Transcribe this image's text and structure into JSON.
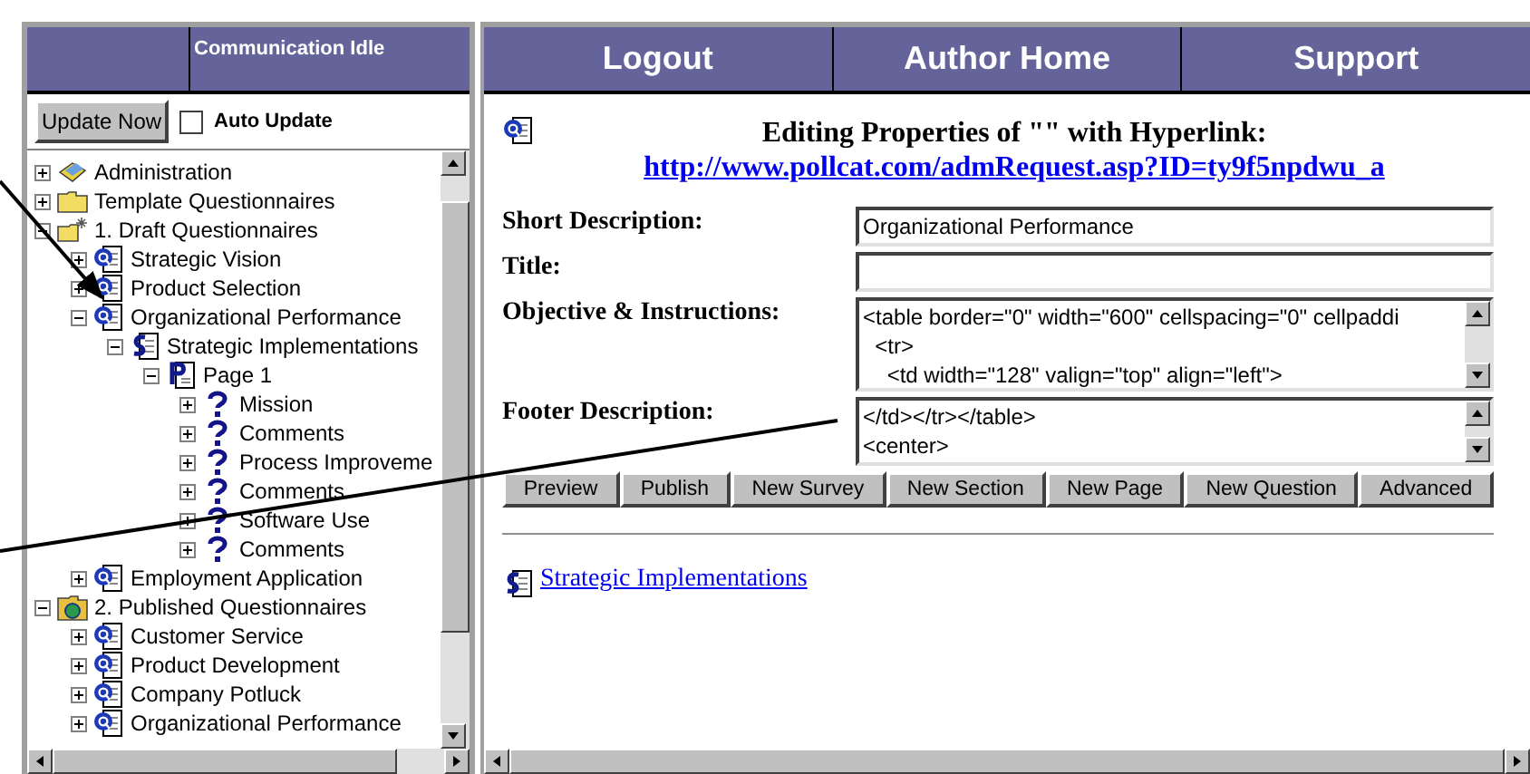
{
  "left_panel": {
    "status": "Communication Idle",
    "update_button": "Update Now",
    "auto_update": {
      "label": "Auto Update",
      "checked": false
    },
    "tree": [
      {
        "label": "Administration",
        "kind": "admin",
        "expanded": false
      },
      {
        "label": "Template Questionnaires",
        "kind": "folder",
        "expanded": false
      },
      {
        "label": "1. Draft Questionnaires",
        "kind": "draft-folder",
        "expanded": true,
        "children": [
          {
            "label": "Strategic Vision",
            "kind": "questionnaire",
            "expanded": false
          },
          {
            "label": "Product Selection",
            "kind": "questionnaire",
            "expanded": false
          },
          {
            "label": "Organizational Performance",
            "kind": "questionnaire",
            "expanded": true,
            "children": [
              {
                "label": "Strategic Implementations",
                "kind": "section",
                "expanded": true,
                "children": [
                  {
                    "label": "Page 1",
                    "kind": "page",
                    "expanded": true,
                    "children": [
                      {
                        "label": "Mission",
                        "kind": "question",
                        "expanded": false
                      },
                      {
                        "label": "Comments",
                        "kind": "question",
                        "expanded": false
                      },
                      {
                        "label": "Process Improveme",
                        "kind": "question",
                        "expanded": false
                      },
                      {
                        "label": "Comments",
                        "kind": "question",
                        "expanded": false
                      },
                      {
                        "label": "Software Use",
                        "kind": "question",
                        "expanded": false
                      },
                      {
                        "label": "Comments",
                        "kind": "question",
                        "expanded": false
                      }
                    ]
                  }
                ]
              }
            ]
          },
          {
            "label": "Employment Application",
            "kind": "questionnaire",
            "expanded": false
          }
        ]
      },
      {
        "label": "2. Published Questionnaires",
        "kind": "published-folder",
        "expanded": true,
        "children": [
          {
            "label": "Customer Service",
            "kind": "questionnaire",
            "expanded": false
          },
          {
            "label": "Product Development",
            "kind": "questionnaire",
            "expanded": false
          },
          {
            "label": "Company Potluck",
            "kind": "questionnaire",
            "expanded": false
          },
          {
            "label": "Organizational Performance",
            "kind": "questionnaire",
            "expanded": false
          }
        ]
      }
    ]
  },
  "nav": [
    "Logout",
    "Author Home",
    "Support"
  ],
  "heading": {
    "title": "Editing Properties of \"\" with Hyperlink:",
    "link": "http://www.pollcat.com/admRequest.asp?ID=ty9f5npdwu_a"
  },
  "fields": [
    {
      "label": "Short Description:",
      "kind": "input",
      "value": "Organizational Performance"
    },
    {
      "label": "Title:",
      "kind": "input"
    },
    {
      "label": "Objective & Instructions:",
      "kind": "textarea",
      "lines": [
        "<table border=\"0\" width=\"600\" cellspacing=\"0\" cellpaddi",
        "  <tr>",
        "    <td width=\"128\" valign=\"top\" align=\"left\">"
      ]
    },
    {
      "label": "Footer Description:",
      "kind": "textarea",
      "lines": [
        "</td></tr></table>",
        "<center>"
      ]
    }
  ],
  "buttons": [
    "Preview",
    "Publish",
    "New Survey",
    "New Section",
    "New Page",
    "New Question",
    "Advanced"
  ],
  "section_link": "Strategic Implementations"
}
